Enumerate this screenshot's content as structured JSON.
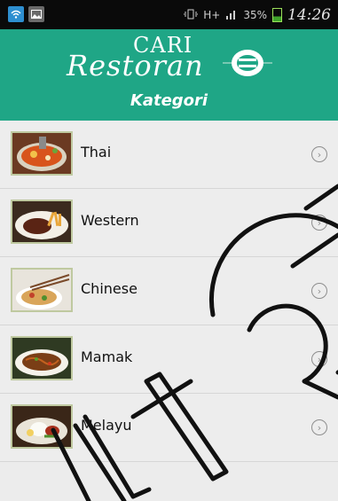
{
  "status_bar": {
    "battery_text": "35%",
    "signal_text": "H+",
    "time": "14:26"
  },
  "header": {
    "logo_top": "CARI",
    "logo_bottom": "Restoran",
    "title": "Kategori",
    "background_color": "#1fa686"
  },
  "categories": [
    {
      "label": "Thai",
      "image": "tom-yum-soup-photo"
    },
    {
      "label": "Western",
      "image": "steak-and-fries-photo"
    },
    {
      "label": "Chinese",
      "image": "noodles-with-chopsticks-photo"
    },
    {
      "label": "Mamak",
      "image": "fried-noodles-photo"
    },
    {
      "label": "Melayu",
      "image": "nasi-lemak-photo"
    }
  ],
  "chevron_icon": "chevron-right-circle-icon"
}
